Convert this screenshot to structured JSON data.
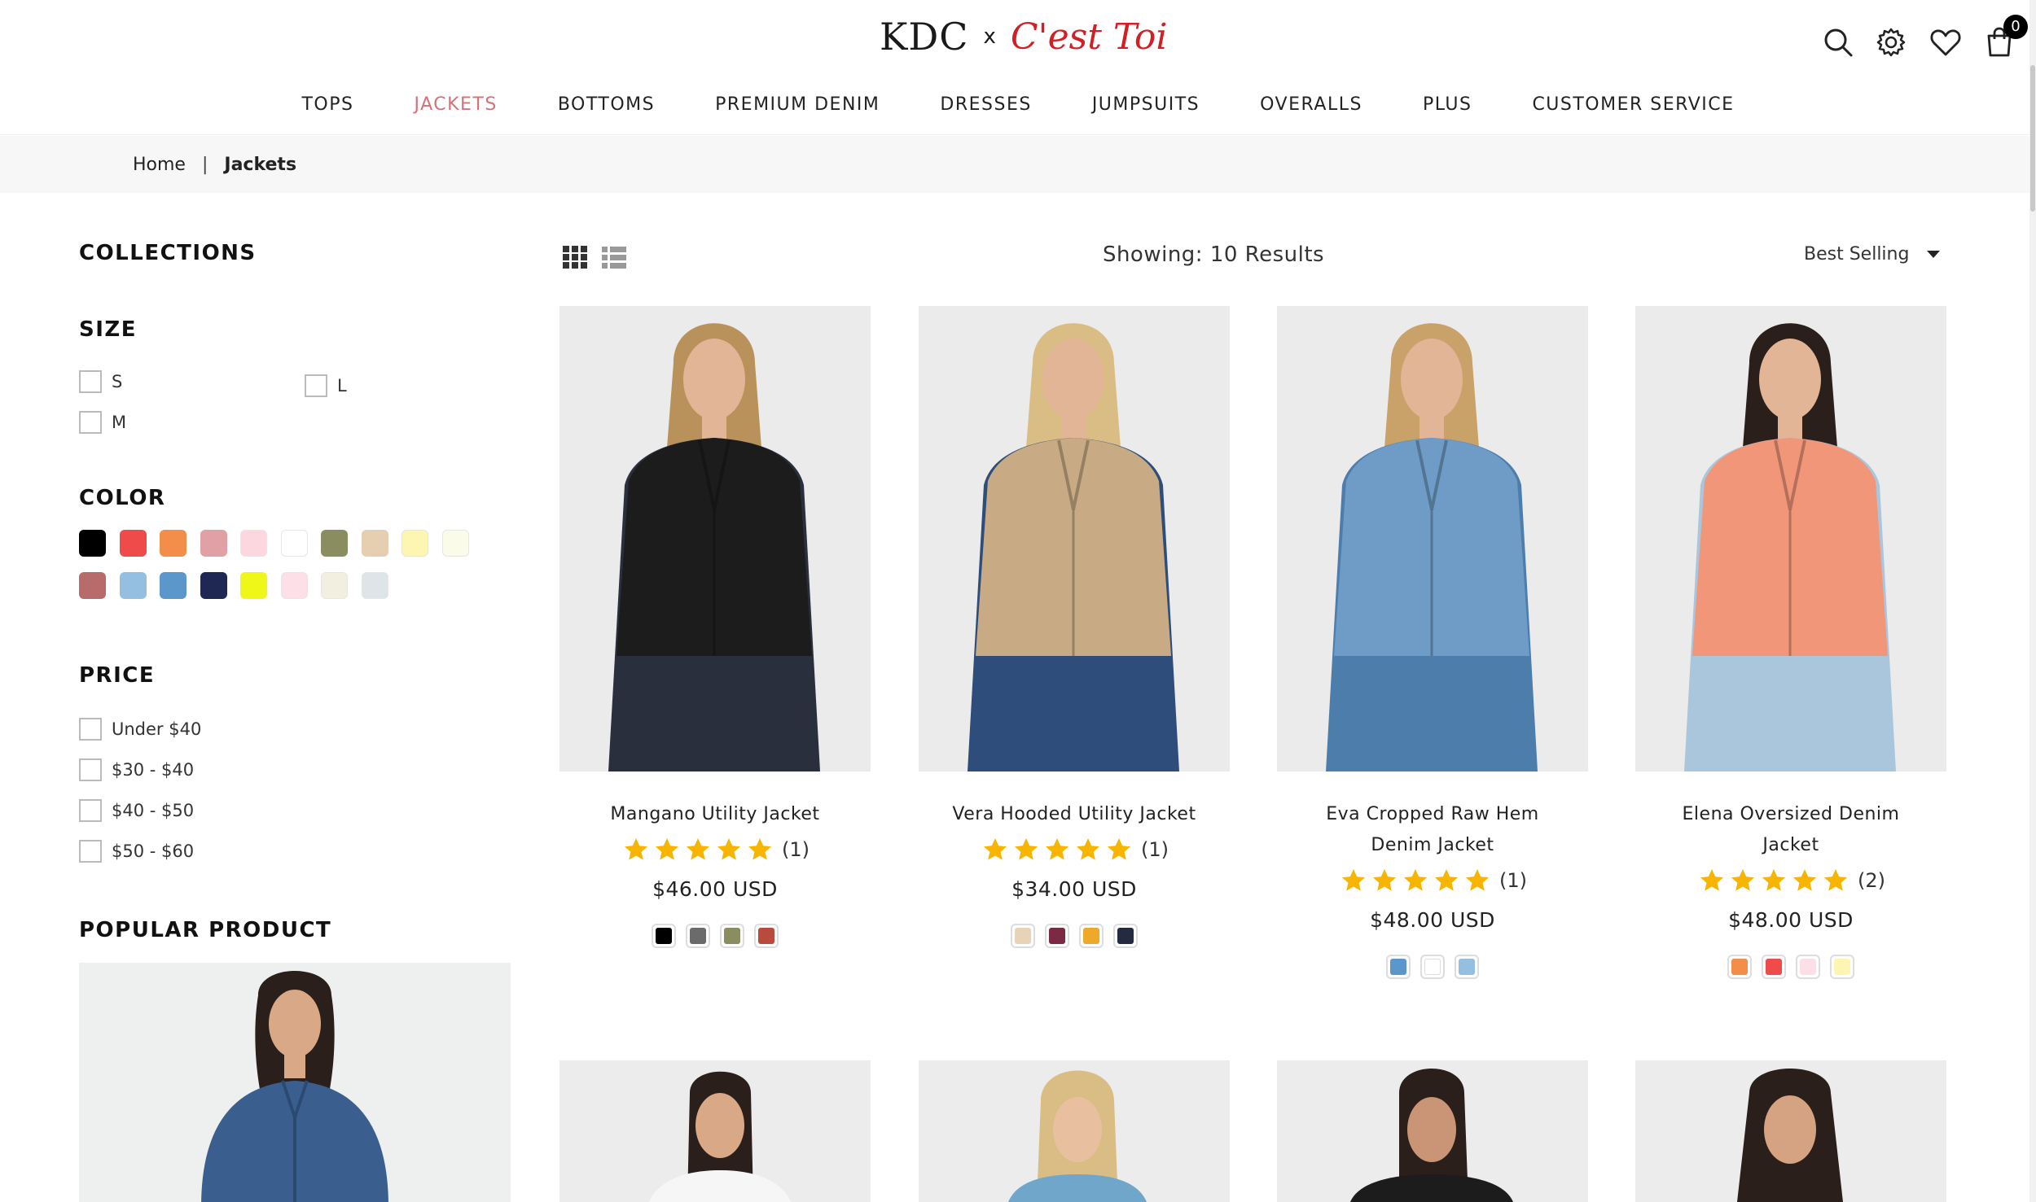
{
  "brand": {
    "kdc": "KDC",
    "x": "x",
    "cest": "C'est Toi"
  },
  "header": {
    "cart_count": "0"
  },
  "nav": [
    {
      "label": "TOPS",
      "active": false
    },
    {
      "label": "JACKETS",
      "active": true
    },
    {
      "label": "BOTTOMS",
      "active": false
    },
    {
      "label": "PREMIUM DENIM",
      "active": false
    },
    {
      "label": "DRESSES",
      "active": false
    },
    {
      "label": "JUMPSUITS",
      "active": false
    },
    {
      "label": "OVERALLS",
      "active": false
    },
    {
      "label": "PLUS",
      "active": false
    },
    {
      "label": "CUSTOMER SERVICE",
      "active": false
    }
  ],
  "breadcrumb": {
    "home": "Home",
    "sep": "|",
    "current": "Jackets"
  },
  "sidebar": {
    "collections": "COLLECTIONS",
    "size": {
      "title": "SIZE",
      "options": [
        "S",
        "L",
        "M"
      ]
    },
    "color": {
      "title": "COLOR",
      "swatches": [
        "#000000",
        "#f04b4b",
        "#f28d4a",
        "#e0a0a6",
        "#fcd7e0",
        "#ffffff",
        "#8a8d60",
        "#e5cfb0",
        "#fdf6b2",
        "#fbfbea",
        "#b86b6b",
        "#95bfe0",
        "#5c97cb",
        "#1f2753",
        "#eef718",
        "#fde0e7",
        "#f2efe0",
        "#dde5e8"
      ]
    },
    "price": {
      "title": "PRICE",
      "options": [
        "Under $40",
        "$30 - $40",
        "$40 - $50",
        "$50 - $60"
      ]
    },
    "popular": "POPULAR PRODUCT"
  },
  "toolbar": {
    "showing": "Showing: 10 Results",
    "sort": "Best Selling"
  },
  "products": [
    {
      "name": "Mangano Utility Jacket",
      "rating": 5,
      "reviews": "(1)",
      "price": "$46.00 USD",
      "swatches": [
        "#000000",
        "#6b6b6b",
        "#8a8d60",
        "#b84a3e"
      ],
      "jacket": "#1c1c1c",
      "pants": "#2a2f3d",
      "hair": "#b8925a"
    },
    {
      "name": "Vera Hooded Utility Jacket",
      "rating": 5,
      "reviews": "(1)",
      "price": "$34.00 USD",
      "swatches": [
        "#e8d3b8",
        "#7b2a43",
        "#efa928",
        "#242a40"
      ],
      "jacket": "#c8ab84",
      "pants": "#2f4d7a",
      "hair": "#d9bd84"
    },
    {
      "name": "Eva Cropped Raw Hem Denim Jacket",
      "rating": 5,
      "reviews": "(1)",
      "price": "$48.00 USD",
      "swatches": [
        "#5c97cb",
        "#ffffff",
        "#95bfe0"
      ],
      "jacket": "#6f9cc6",
      "pants": "#4d7eab",
      "hair": "#c9a26a"
    },
    {
      "name": "Elena Oversized Denim Jacket",
      "rating": 5,
      "reviews": "(2)",
      "price": "$48.00 USD",
      "swatches": [
        "#f28d4a",
        "#f04b4b",
        "#fde0e7",
        "#fdf6b2"
      ],
      "jacket": "#f2967a",
      "pants": "#a9c6dc",
      "hair": "#2a1f1a"
    }
  ]
}
